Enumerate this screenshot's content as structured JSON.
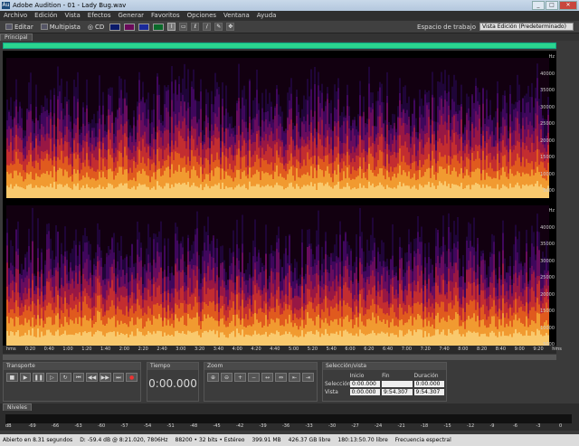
{
  "title": "Adobe Audition - 01 - Lady Bug.wav",
  "menu": [
    "Archivo",
    "Edición",
    "Vista",
    "Efectos",
    "Generar",
    "Favoritos",
    "Opciones",
    "Ventana",
    "Ayuda"
  ],
  "toolbar": {
    "edit": "Editar",
    "multitrack": "Multipista",
    "cd": "CD",
    "workspace_label": "Espacio de trabajo",
    "workspace_value": "Vista Edición (Predeterminado)"
  },
  "tab_main": "Principal",
  "hz_labels": [
    "Hz",
    "40000",
    "35000",
    "30000",
    "25000",
    "20000",
    "15000",
    "10000",
    "5000"
  ],
  "time_labels": [
    "hms",
    "0:20",
    "0:40",
    "1:00",
    "1:20",
    "1:40",
    "2:00",
    "2:20",
    "2:40",
    "3:00",
    "3:20",
    "3:40",
    "4:00",
    "4:20",
    "4:40",
    "5:00",
    "5:20",
    "5:40",
    "6:00",
    "6:20",
    "6:40",
    "7:00",
    "7:20",
    "7:40",
    "8:00",
    "8:20",
    "8:40",
    "9:00",
    "9:20",
    "hms"
  ],
  "panels": {
    "transport": "Transporte",
    "time": "Tiempo",
    "zoom": "Zoom",
    "selection": "Selección/vista",
    "time_value": "0:00.000"
  },
  "selection": {
    "h_start": "Inicio",
    "h_end": "Fin",
    "h_dur": "Duración",
    "sel": "Selección",
    "view": "Vista",
    "s_start": "0:00.000",
    "s_end": "",
    "s_dur": "0:00.000",
    "v_start": "0:00.000",
    "v_end": "9:54.307",
    "v_dur": "9:54.307"
  },
  "levels": {
    "title": "Niveles",
    "ticks": [
      "dB",
      "-69",
      "-66",
      "-63",
      "-60",
      "-57",
      "-54",
      "-51",
      "-48",
      "-45",
      "-42",
      "-39",
      "-36",
      "-33",
      "-30",
      "-27",
      "-24",
      "-21",
      "-18",
      "-15",
      "-12",
      "-9",
      "-6",
      "-3",
      "0"
    ]
  },
  "status": [
    "Abierto en 8.31 segundos",
    "D: -59.4 dB @ 8:21.020, 7806Hz",
    "88200 • 32 bits • Estéreo",
    "399.91 MB",
    "426.37 GB libre",
    "180:13:50.70 libre",
    "Frecuencia espectral"
  ]
}
